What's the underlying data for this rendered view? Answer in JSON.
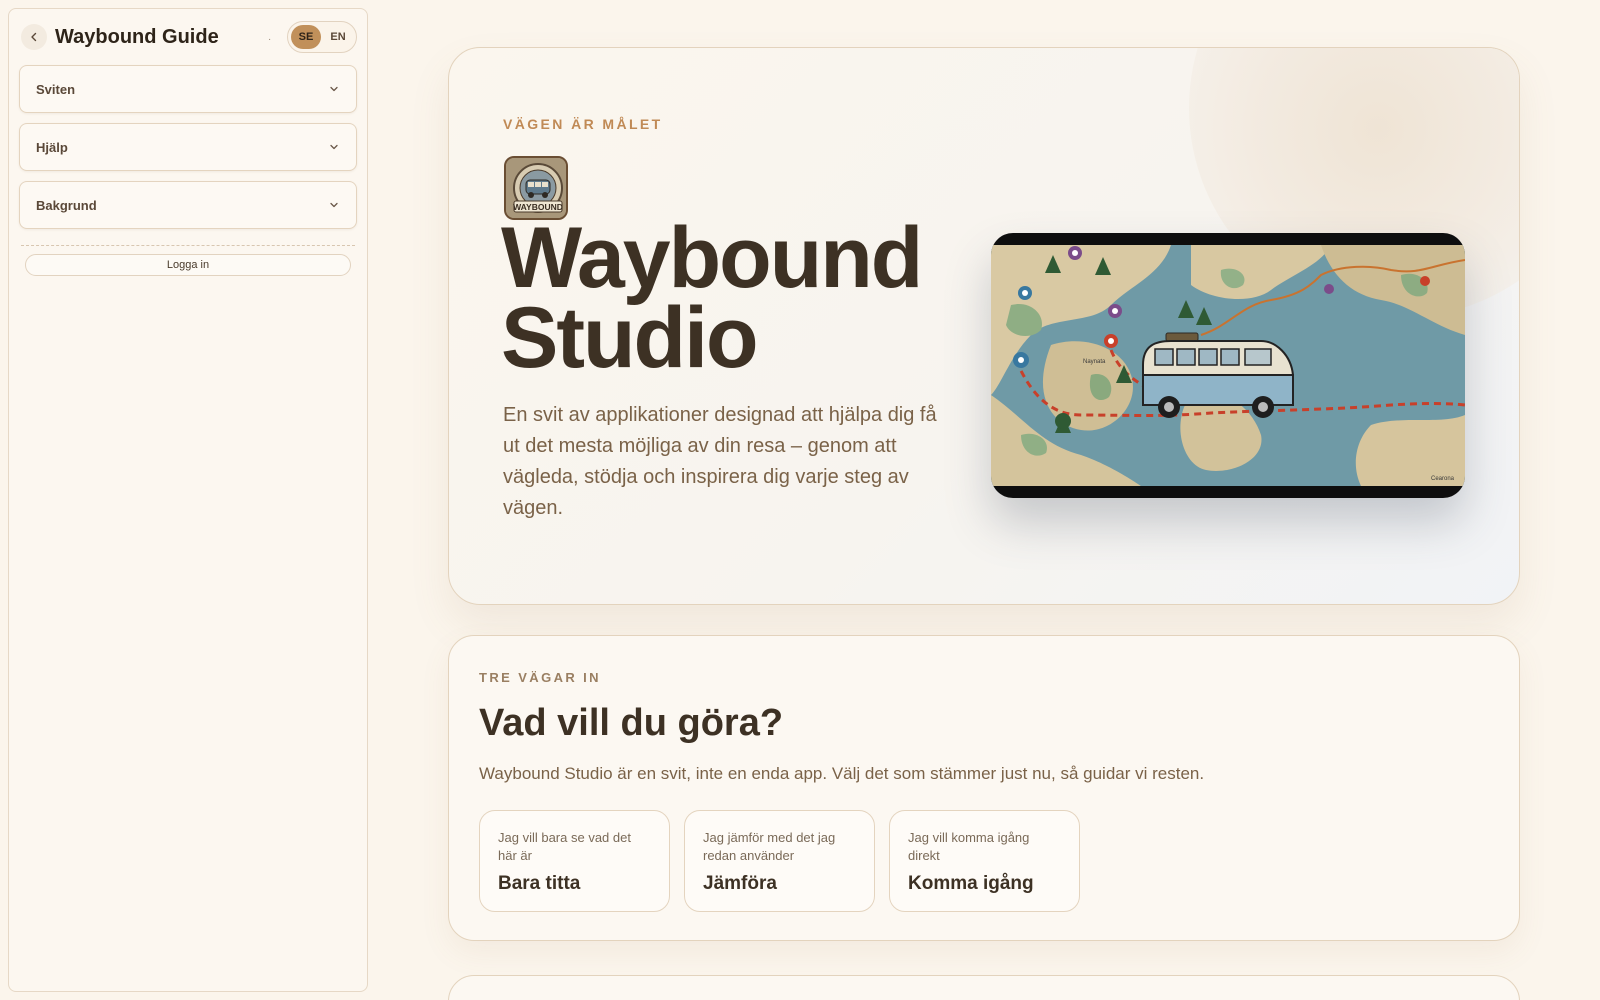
{
  "sidebar": {
    "title": "Waybound Guide",
    "dot": ".",
    "lang": {
      "se": "SE",
      "en": "EN",
      "active": "SE"
    },
    "sections": [
      {
        "label": "Sviten"
      },
      {
        "label": "Hjälp"
      },
      {
        "label": "Bakgrund"
      }
    ],
    "login_label": "Logga in"
  },
  "hero": {
    "eyebrow": "VÄGEN ÄR MÅLET",
    "logo_text": "WAYBOUND",
    "title_line1": "Waybound",
    "title_line2": "Studio",
    "description": "En svit av applikationer designad att hjälpa dig få ut det mesta möjliga av din resa – genom att vägleda, stödja och inspirera dig varje steg av vägen.",
    "map_labels": [
      "Naynata",
      "Cearona"
    ]
  },
  "paths": {
    "eyebrow": "TRE VÄGAR IN",
    "title": "Vad vill du göra?",
    "description": "Waybound Studio är en svit, inte en enda app. Välj det som stämmer just nu, så guidar vi resten.",
    "choices": [
      {
        "sub": "Jag vill bara se vad det här är",
        "title": "Bara titta"
      },
      {
        "sub": "Jag jämför med det jag redan använder",
        "title": "Jämföra"
      },
      {
        "sub": "Jag vill komma igång direkt",
        "title": "Komma igång"
      }
    ]
  },
  "colors": {
    "background": "#fbf5ec",
    "accent": "#c1905a",
    "eyebrow": "#c08a55",
    "text_dark": "#3d3124",
    "text_muted": "#7a6248"
  },
  "icons": [
    "chevron-left-icon",
    "chevron-down-icon"
  ]
}
